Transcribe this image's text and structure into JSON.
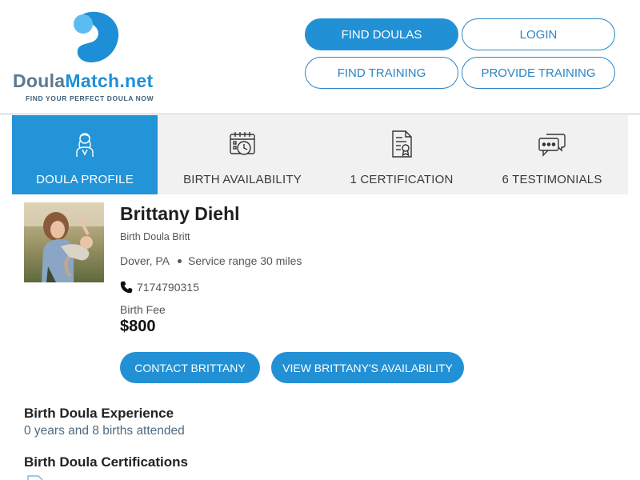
{
  "brand": {
    "name_part1": "Doula",
    "name_part2": "Match.net",
    "tagline": "FIND YOUR PERFECT DOULA NOW",
    "color_primary": "#2290d4",
    "color_secondary": "#5a7991"
  },
  "nav": {
    "find_doulas": "FIND DOULAS",
    "login": "LOGIN",
    "find_training": "FIND TRAINING",
    "provide_training": "PROVIDE TRAINING"
  },
  "tabs": [
    {
      "label": "DOULA PROFILE",
      "icon": "doula-person-icon",
      "active": true
    },
    {
      "label": "BIRTH AVAILABILITY",
      "icon": "calendar-clock-icon",
      "active": false
    },
    {
      "label": "1 CERTIFICATION",
      "icon": "certificate-document-icon",
      "active": false
    },
    {
      "label": "6 TESTIMONIALS",
      "icon": "chat-bubbles-icon",
      "active": false
    }
  ],
  "profile": {
    "name": "Brittany Diehl",
    "subtitle": "Birth Doula Britt",
    "location": "Dover, PA",
    "service_range": "Service range 30 miles",
    "phone": "7174790315",
    "fee_label": "Birth Fee",
    "fee": "$800",
    "photo_icon": "profile-photo"
  },
  "actions": {
    "contact": "CONTACT BRITTANY",
    "availability": "VIEW BRITTANY'S AVAILABILITY"
  },
  "sections": {
    "experience_title": "Birth Doula Experience",
    "experience_text": "0 years and 8 births attended",
    "certifications_title": "Birth Doula Certifications"
  }
}
